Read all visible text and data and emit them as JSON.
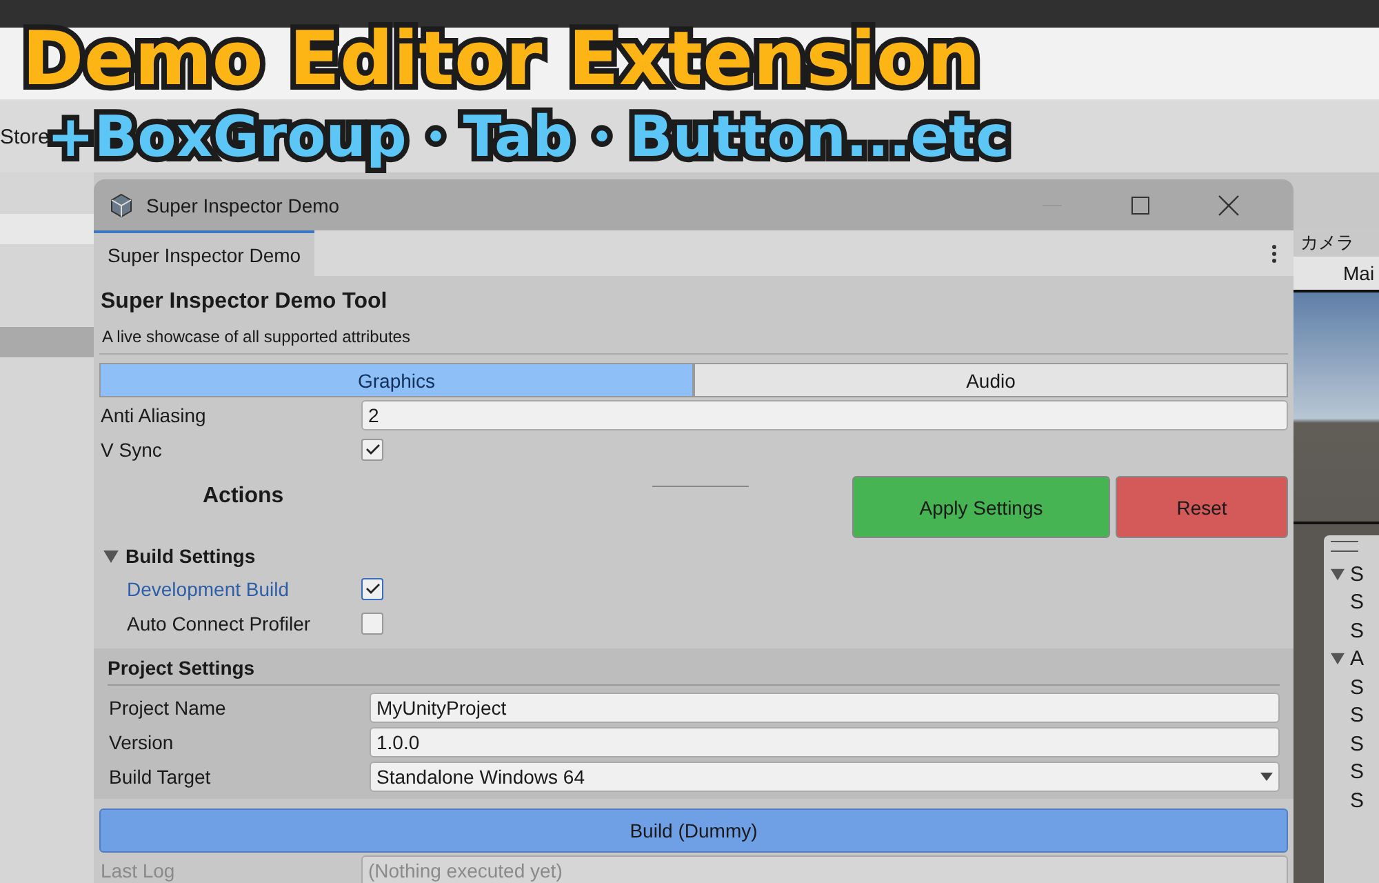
{
  "overlay_title": {
    "line_1": "Demo Editor Extension",
    "line_2": "+BoxGroup・Tab・Button...etc"
  },
  "background_editor": {
    "toolbar_item": "Store",
    "hierarchy_label": "カメラ",
    "camera_field": "Mai",
    "scene_overlay": [
      {
        "arrow": true,
        "text": "S"
      },
      {
        "arrow": false,
        "text": "S"
      },
      {
        "arrow": false,
        "text": "S"
      },
      {
        "arrow": true,
        "text": "A"
      },
      {
        "arrow": false,
        "text": "S"
      },
      {
        "arrow": false,
        "text": "S"
      },
      {
        "arrow": false,
        "text": "S"
      },
      {
        "arrow": false,
        "text": "S"
      },
      {
        "arrow": false,
        "text": "S"
      }
    ]
  },
  "window": {
    "title": "Super Inspector Demo",
    "tab": "Super Inspector Demo",
    "heading": "Super Inspector Demo Tool",
    "subtitle": "A live showcase of all supported attributes",
    "tabs": [
      {
        "label": "Graphics",
        "selected": true
      },
      {
        "label": "Audio",
        "selected": false
      }
    ],
    "fields": [
      {
        "kind": "text",
        "label": "Anti Aliasing",
        "value": "2"
      },
      {
        "kind": "toggle",
        "label": "V Sync",
        "checked": true
      }
    ],
    "actions": {
      "label": "Actions",
      "buttons": [
        {
          "label": "Apply Settings",
          "color": "#47b453"
        },
        {
          "label": "Reset",
          "color": "#d45a5a"
        }
      ]
    },
    "build_settings": {
      "title": "Build Settings",
      "expanded": true,
      "items": [
        {
          "label": "Development Build",
          "checked": true,
          "focused": true
        },
        {
          "label": "Auto Connect Profiler",
          "checked": false,
          "focused": false
        }
      ]
    },
    "project_settings": {
      "title": "Project Settings",
      "fields": [
        {
          "kind": "text",
          "label": "Project Name",
          "value": "MyUnityProject"
        },
        {
          "kind": "text",
          "label": "Version",
          "value": "1.0.0"
        },
        {
          "kind": "dropdown",
          "label": "Build Target",
          "value": "Standalone Windows 64"
        }
      ]
    },
    "build_button": "Build (Dummy)",
    "last_log": {
      "label": "Last Log",
      "value": "(Nothing executed yet)",
      "disabled": true
    }
  }
}
